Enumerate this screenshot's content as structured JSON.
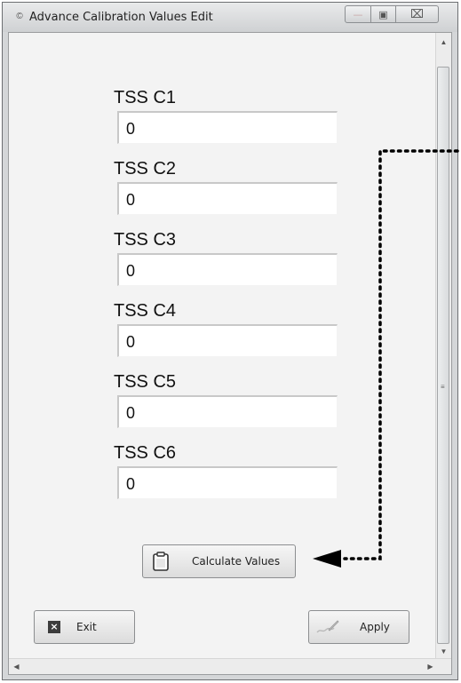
{
  "window": {
    "title": "Advance Calibration Values Edit",
    "app_icon_glyph": "©",
    "minimize_glyph": "—",
    "maximize_glyph": "▣",
    "close_glyph": "⌧"
  },
  "fields": [
    {
      "label": "TSS C1",
      "value": "0"
    },
    {
      "label": "TSS C2",
      "value": "0"
    },
    {
      "label": "TSS C3",
      "value": "0"
    },
    {
      "label": "TSS C4",
      "value": "0"
    },
    {
      "label": "TSS C5",
      "value": "0"
    },
    {
      "label": "TSS C6",
      "value": "0"
    }
  ],
  "buttons": {
    "calculate_label": "Calculate Values",
    "calculate_icon": "clipboard-icon",
    "exit_label": "Exit",
    "exit_icon": "close-box-icon",
    "apply_label": "Apply",
    "apply_icon": "signature-pen-icon"
  },
  "scrollbar": {
    "up_glyph": "▲",
    "down_glyph": "▼",
    "left_glyph": "◀",
    "right_glyph": "▶",
    "grip_glyph": "≡"
  },
  "colors": {
    "annotation": "#000000",
    "window_frame": "#d4d6d8",
    "client_bg": "#f3f3f3"
  }
}
